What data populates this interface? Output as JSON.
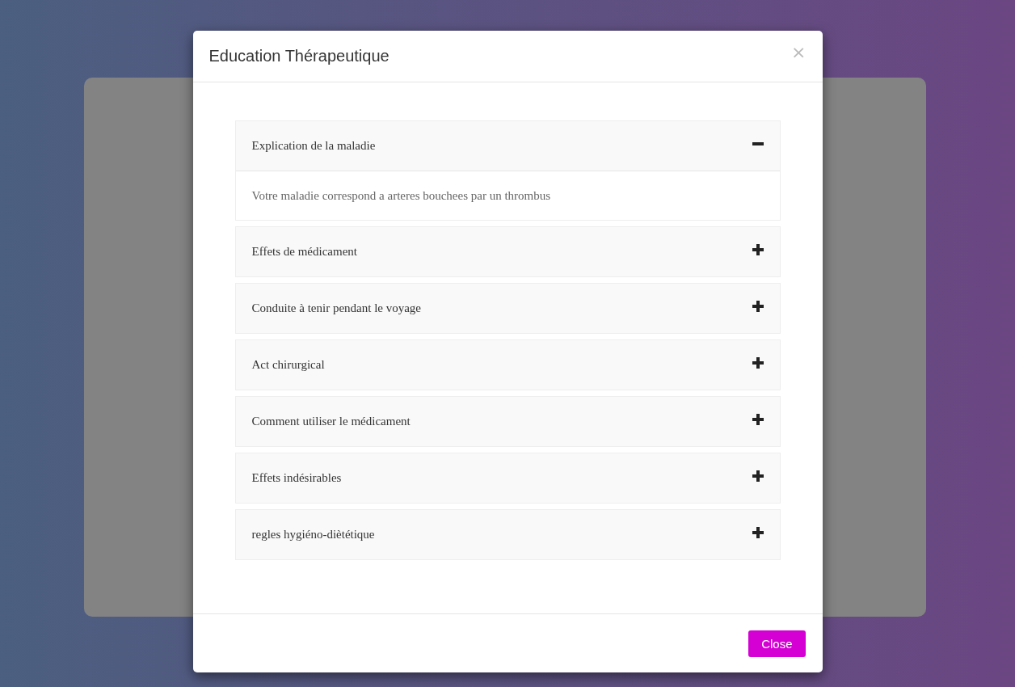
{
  "modal": {
    "title": "Education Thérapeutique",
    "close_icon": "×",
    "sections": [
      {
        "title": "Explication de la maladie",
        "expanded": true,
        "content": "Votre maladie correspond a arteres bouchees par un thrombus"
      },
      {
        "title": "Effets de médicament",
        "expanded": false
      },
      {
        "title": "Conduite à tenir pendant le voyage",
        "expanded": false
      },
      {
        "title": "Act chirurgical",
        "expanded": false
      },
      {
        "title": "Comment utiliser le médicament",
        "expanded": false
      },
      {
        "title": "Effets indésirables",
        "expanded": false
      },
      {
        "title": "regles hygiéno-diètétique",
        "expanded": false
      }
    ],
    "footer_button": "Close"
  }
}
